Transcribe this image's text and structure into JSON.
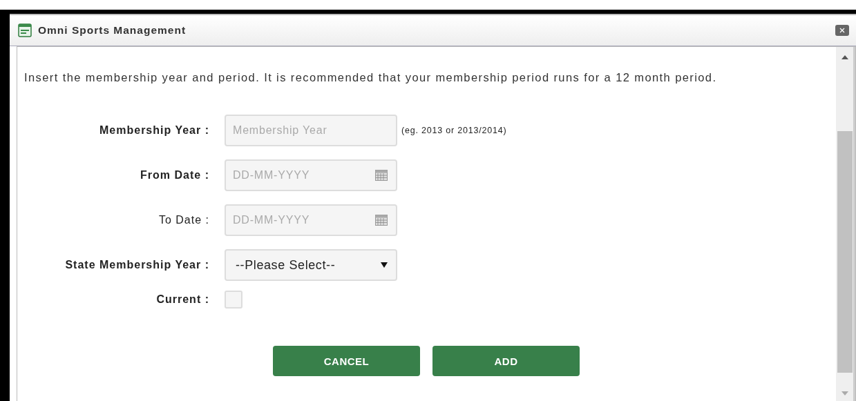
{
  "window": {
    "title": "Omni Sports Management"
  },
  "intro": "Insert the membership year and period. It is recommended that your membership period runs for a 12 month period.",
  "fields": [
    {
      "kind": "text",
      "label": "Membership Year :",
      "bold": true,
      "placeholder": "Membership Year",
      "hint": "(eg. 2013 or 2013/2014)"
    },
    {
      "kind": "date",
      "label": "From Date :",
      "bold": true,
      "placeholder": "DD-MM-YYYY"
    },
    {
      "kind": "date",
      "label": "To Date :",
      "bold": false,
      "placeholder": "DD-MM-YYYY"
    },
    {
      "kind": "select",
      "label": "State Membership Year :",
      "bold": true,
      "value": "--Please Select--"
    },
    {
      "kind": "checkbox",
      "label": "Current :",
      "bold": true,
      "checked": false
    }
  ],
  "buttons": [
    "CANCEL",
    "ADD"
  ]
}
